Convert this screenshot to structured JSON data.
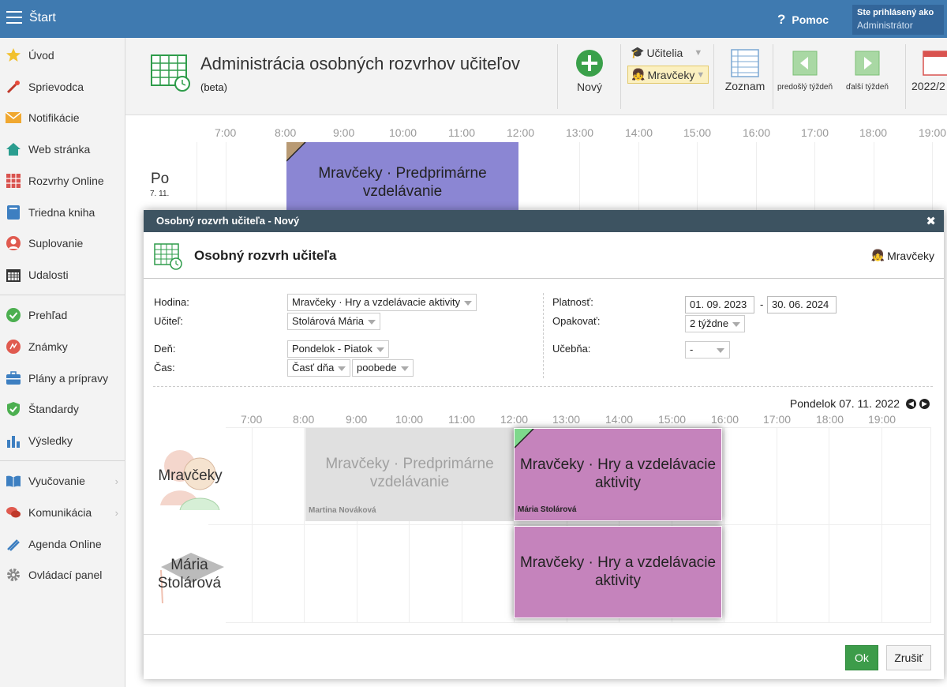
{
  "topbar": {
    "title": "Štart",
    "help": "Pomoc",
    "user_line1": "Ste prihlásený ako",
    "user_line2": "Administrátor"
  },
  "sidebar": {
    "items": [
      {
        "label": "Úvod",
        "icon": "star-icon"
      },
      {
        "label": "Sprievodca",
        "icon": "wand-icon"
      },
      {
        "label": "Notifikácie",
        "icon": "envelope-icon"
      },
      {
        "label": "Web stránka",
        "icon": "home-icon"
      },
      {
        "label": "Rozvrhy Online",
        "icon": "timetable-icon"
      },
      {
        "label": "Triedna kniha",
        "icon": "book-icon"
      },
      {
        "label": "Suplovanie",
        "icon": "person-icon"
      },
      {
        "label": "Udalosti",
        "icon": "calendar-icon"
      },
      {
        "label": "Prehľad",
        "icon": "check-icon"
      },
      {
        "label": "Známky",
        "icon": "grades-icon"
      },
      {
        "label": "Plány a prípravy",
        "icon": "briefcase-icon"
      },
      {
        "label": "Štandardy",
        "icon": "shield-icon"
      },
      {
        "label": "Výsledky",
        "icon": "barchart-icon"
      },
      {
        "label": "Vyučovanie",
        "icon": "open-book-icon"
      },
      {
        "label": "Komunikácia",
        "icon": "chat-icon"
      },
      {
        "label": "Agenda Online",
        "icon": "pen-icon"
      },
      {
        "label": "Ovládací panel",
        "icon": "gear-icon"
      }
    ]
  },
  "header": {
    "title": "Administrácia osobných rozvrhov učiteľov",
    "subtitle": "(beta)",
    "new_label": "Nový",
    "teachers_label": "Učitelia",
    "selected_class": "Mravčeky",
    "list_label": "Zoznam",
    "prev_week": "predošlý týždeň",
    "next_week": "ďalší týždeň",
    "year": "2022/2"
  },
  "background_schedule": {
    "hours": [
      "7:00",
      "8:00",
      "9:00",
      "10:00",
      "11:00",
      "12:00",
      "13:00",
      "14:00",
      "15:00",
      "16:00",
      "17:00",
      "18:00",
      "19:00"
    ],
    "day": "Po",
    "day_date": "7. 11.",
    "event": "Mravčeky · Predprimárne vzdelávanie"
  },
  "modal": {
    "header": "Osobný rozvrh učiteľa - Nový",
    "title": "Osobný rozvrh učiteľa",
    "right_label": "Mravčeky",
    "form": {
      "hodina_label": "Hodina:",
      "hodina_value": "Mravčeky · Hry a vzdelávacie aktivity",
      "ucitel_label": "Učiteľ:",
      "ucitel_value": "Stolárová Mária",
      "den_label": "Deň:",
      "den_value": "Pondelok - Piatok",
      "cas_label": "Čas:",
      "cas_value1": "Časť dňa",
      "cas_value2": "poobede",
      "platnost_label": "Platnosť:",
      "platnost_from": "01. 09. 2023",
      "platnost_sep": "-",
      "platnost_to": "30. 06. 2024",
      "opakovat_label": "Opakovať:",
      "opakovat_value": "2 týždne",
      "ucebna_label": "Učebňa:",
      "ucebna_value": "-"
    },
    "date_nav": "Pondelok 07. 11. 2022",
    "hours": [
      "7:00",
      "8:00",
      "9:00",
      "10:00",
      "11:00",
      "12:00",
      "13:00",
      "14:00",
      "15:00",
      "16:00",
      "17:00",
      "18:00",
      "19:00"
    ],
    "row1_label": "Mravčeky",
    "row2_label": "Mária Stolárová",
    "event_grey": "Mravčeky · Predprimárne vzdelávanie",
    "event_grey_teacher": "Martina Nováková",
    "event_pink": "Mravčeky · Hry a vzdelávacie aktivity",
    "event_pink_teacher": "Mária Stolárová",
    "event_pink2": "Mravčeky · Hry a vzdelávacie aktivity",
    "ok": "Ok",
    "cancel": "Zrušiť"
  },
  "colors": {
    "topbar": "#3f7ab0",
    "modal_header": "#3d5361",
    "event_purple": "#8b86d3",
    "event_pink": "#c583bc",
    "event_grey": "#e0e0e0",
    "ok_green": "#3d9c4a"
  }
}
